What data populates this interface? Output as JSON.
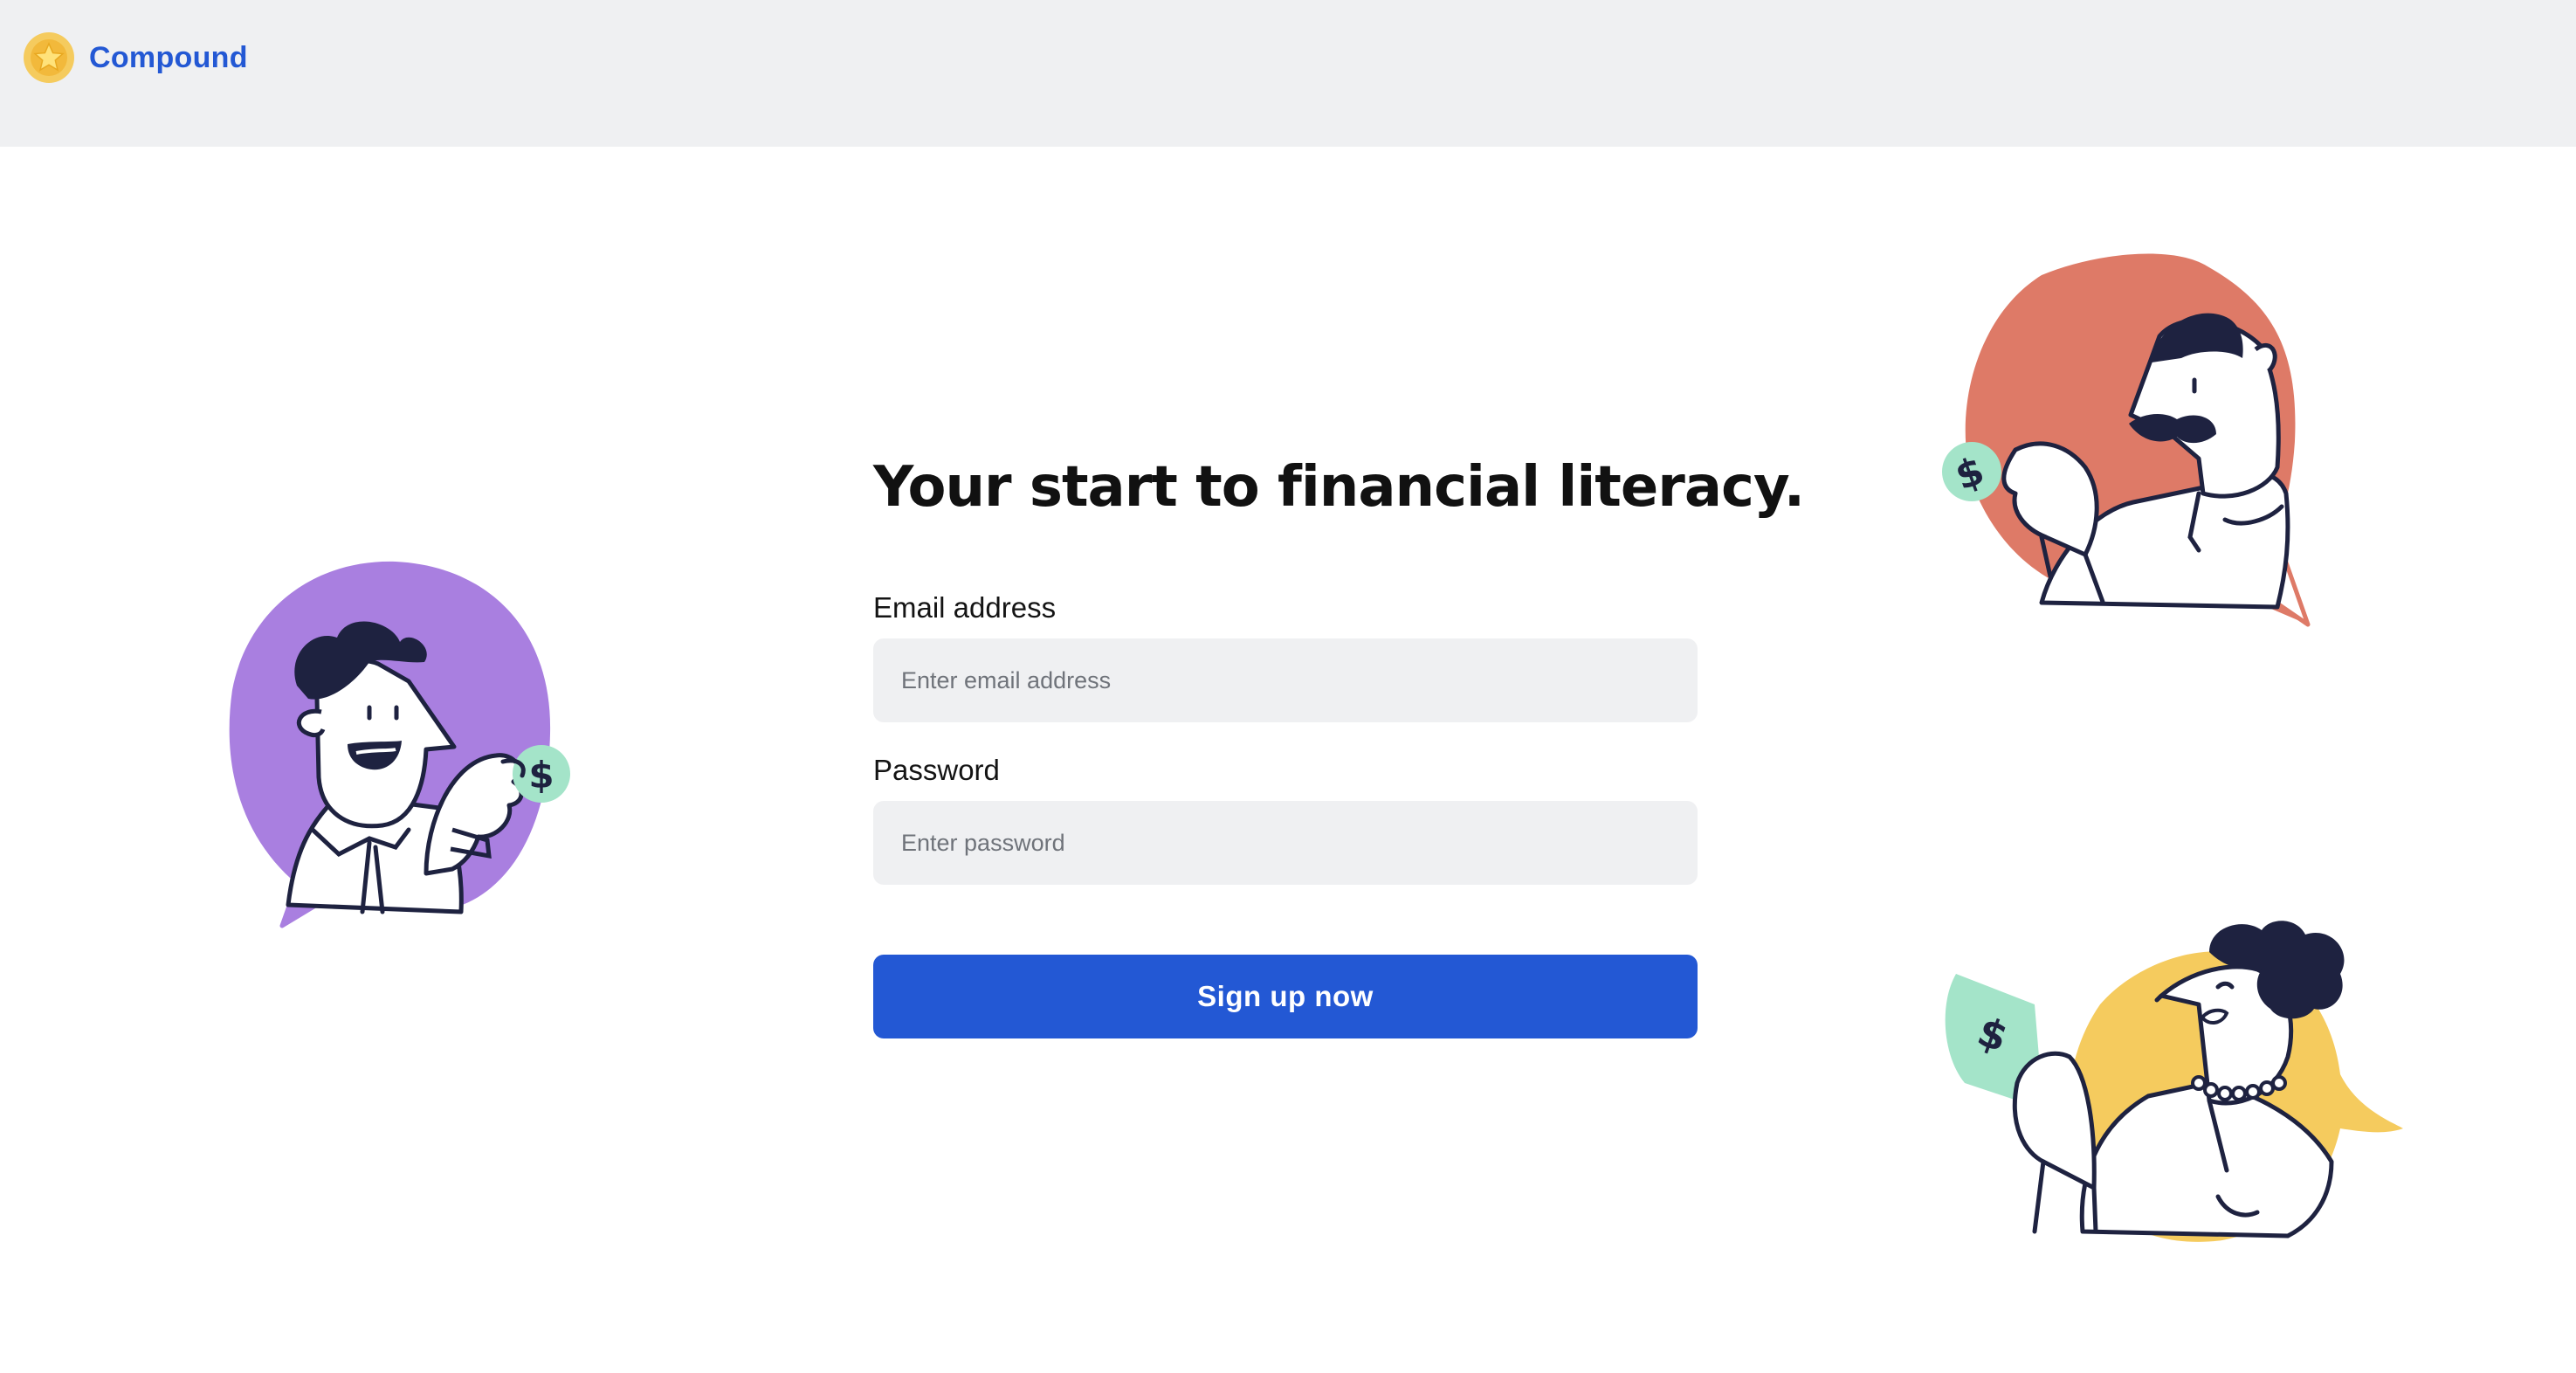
{
  "brand": {
    "name": "Compound",
    "logo_icon": "star-coin-icon"
  },
  "signup": {
    "headline": "Your start to financial literacy.",
    "email_label": "Email address",
    "email_placeholder": "Enter email address",
    "email_value": "",
    "password_label": "Password",
    "password_placeholder": "Enter password",
    "password_value": "",
    "submit_label": "Sign up now"
  },
  "illustrations": {
    "left": "man-with-coin-purple",
    "top_right": "man-with-coin-red",
    "bottom_right": "woman-with-banknote-yellow"
  },
  "colors": {
    "brand_blue": "#2358d4",
    "topbar_bg": "#eff0f2",
    "input_bg": "#eff0f2",
    "purple_blob": "#a97fe0",
    "red_blob": "#de7a67",
    "yellow_blob": "#f5cb5e",
    "mint_money": "#a4e4c9",
    "ink": "#1e2240"
  }
}
